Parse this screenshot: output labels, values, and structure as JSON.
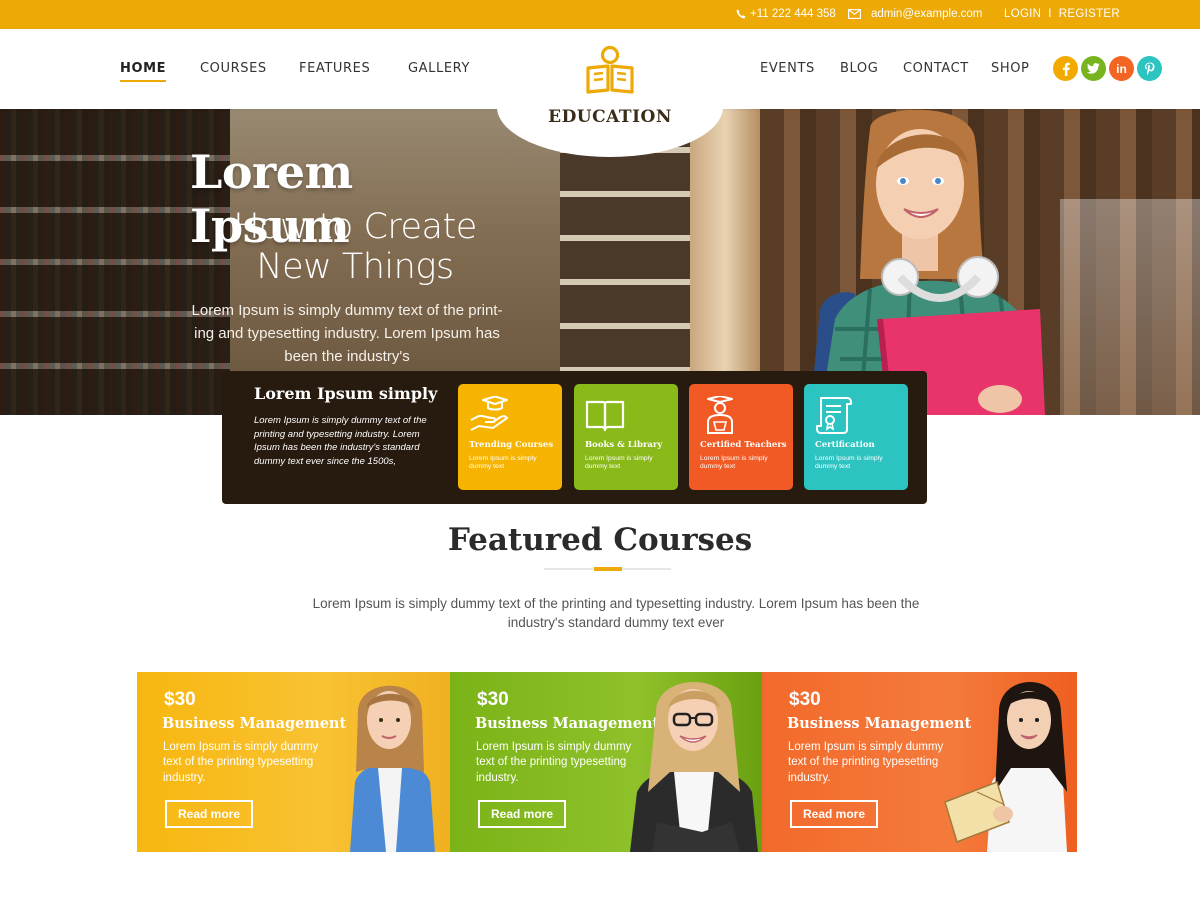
{
  "topbar": {
    "phone": "+11 222 444 358",
    "email": "admin@example.com",
    "login": "LOGIN",
    "separator": "I",
    "register": "REGISTER"
  },
  "nav": {
    "left": [
      "HOME",
      "COURSES",
      "FEATURES",
      "GALLERY"
    ],
    "right": [
      "EVENTS",
      "BLOG",
      "CONTACT",
      "SHOP"
    ],
    "active": "HOME"
  },
  "logo": {
    "text": "EDUCATION",
    "icon": "reading-person-icon"
  },
  "socials": [
    {
      "name": "facebook-icon",
      "glyph": "f",
      "color": "#f2a900"
    },
    {
      "name": "twitter-icon",
      "glyph": "t",
      "color": "#78b41e"
    },
    {
      "name": "linkedin-icon",
      "glyph": "in",
      "color": "#f26522"
    },
    {
      "name": "pinterest-icon",
      "glyph": "p",
      "color": "#2bc4c0"
    }
  ],
  "hero": {
    "title": "Lorem Ipsum",
    "subtitle_line1": "How to Create",
    "subtitle_line2": "New Things",
    "description": "Lorem Ipsum is simply dummy text of the print-ing and typesetting industry. Lorem Ipsum has been the industry's"
  },
  "panel": {
    "title": "Lorem Ipsum simply",
    "text": "Lorem Ipsum is simply dummy text of the printing and typesetting industry. Lorem Ipsum has been the industry's standard dummy text ever since the 1500s,",
    "features": [
      {
        "title": "Trending Courses",
        "text": "Lorem Ipsum is simply dummy text",
        "color": "#f6b400",
        "icon": "graduation-hand-icon"
      },
      {
        "title": "Books & Library",
        "text": "Lorem Ipsum is simply dummy text",
        "color": "#8ab91a",
        "icon": "open-book-icon"
      },
      {
        "title": "Certified Teachers",
        "text": "Lorem Ipsum is simply dummy text",
        "color": "#f15a24",
        "icon": "teacher-icon"
      },
      {
        "title": "Certification",
        "text": "Lorem Ipsum is simply dummy text",
        "color": "#2dc3c0",
        "icon": "certificate-icon"
      }
    ]
  },
  "featured": {
    "title": "Featured Courses",
    "description": "Lorem Ipsum is simply dummy text of the printing and typesetting industry. Lorem Ipsum has been the industry's standard dummy text ever"
  },
  "courses": [
    {
      "price": "$30",
      "title": "Business Management",
      "text": "Lorem Ipsum is simply dummy text of the printing typesetting industry.",
      "button": "Read more",
      "color": "#f7b70f"
    },
    {
      "price": "$30",
      "title": "Business Management",
      "text": "Lorem Ipsum is simply dummy text of the printing typesetting industry.",
      "button": "Read more",
      "color": "#7ab317"
    },
    {
      "price": "$30",
      "title": "Business Management",
      "text": "Lorem Ipsum is simply dummy text of the printing typesetting industry.",
      "button": "Read more",
      "color": "#f26a2b"
    }
  ]
}
